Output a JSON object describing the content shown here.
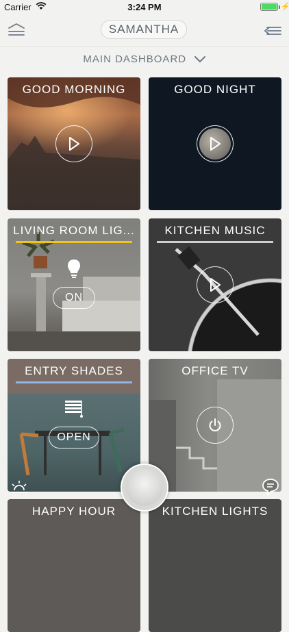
{
  "status_bar": {
    "carrier": "Carrier",
    "time": "3:24 PM",
    "battery_level": 1.0
  },
  "header": {
    "title": "SAMANTHA",
    "left_icon": "menu-icon",
    "right_icon": "collapse-menu-icon"
  },
  "dashboard_selector": {
    "label": "MAIN DASHBOARD",
    "icon": "chevron-down-icon"
  },
  "tiles": [
    {
      "title": "GOOD MORNING",
      "control": "play-icon"
    },
    {
      "title": "GOOD NIGHT",
      "control": "play-icon"
    },
    {
      "title": "LIVING ROOM LIG...",
      "status_icon": "lightbulb-icon",
      "button_label": "ON",
      "accent": "#f0c418"
    },
    {
      "title": "KITCHEN MUSIC",
      "control": "play-icon",
      "accent": "#cfcfcf"
    },
    {
      "title": "ENTRY SHADES",
      "status_icon": "shades-icon",
      "button_label": "OPEN",
      "accent": "#8fb4e6"
    },
    {
      "title": "OFFICE TV",
      "control": "power-icon"
    },
    {
      "title": "HAPPY HOUR"
    },
    {
      "title": "KITCHEN LIGHTS"
    }
  ],
  "bottom": {
    "left_icon": "sunrise-icon",
    "center": "home-button",
    "right_icon": "chat-icon"
  }
}
